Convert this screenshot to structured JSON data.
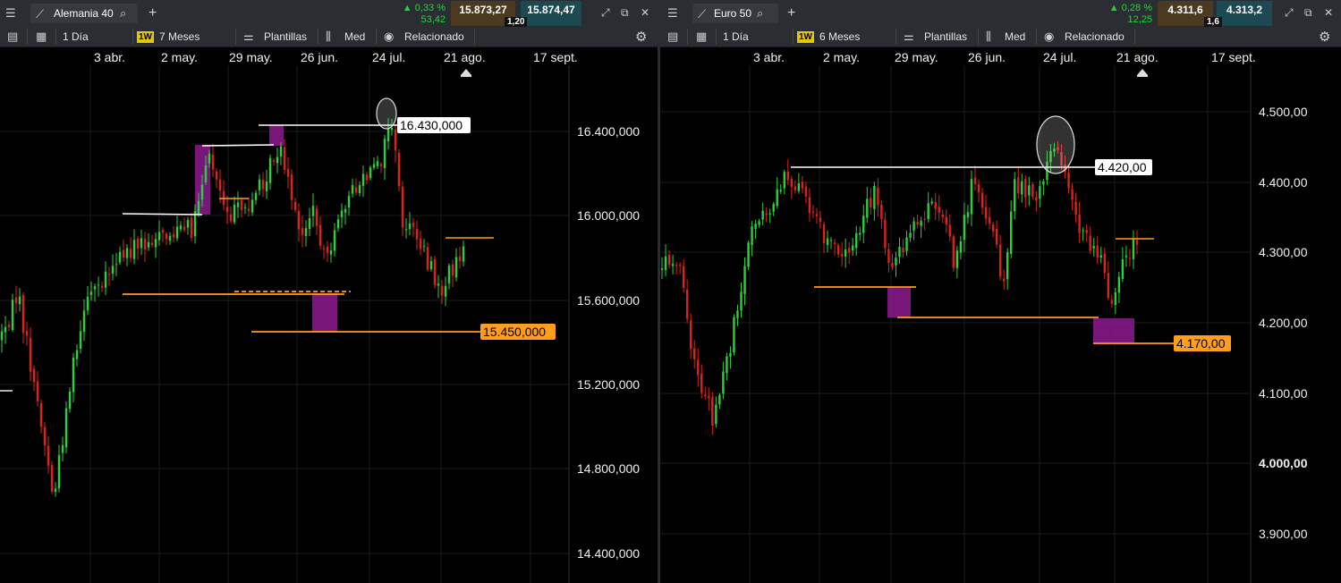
{
  "left": {
    "instrument": "Alemania 40",
    "change_pct": "0,33 %",
    "change_pts": "53,42",
    "sell": "15.873,27",
    "buy": "15.874,47",
    "spread": "1,20",
    "interval": "1 Día",
    "badge": "1W",
    "range": "7 Meses",
    "templates": "Plantillas",
    "indicator": "Med",
    "related": "Relacionado",
    "dates": [
      "3 abr.",
      "2 may.",
      "29 may.",
      "26 jun.",
      "24 jul.",
      "21 ago.",
      "17 sept."
    ],
    "y_labels": [
      "16.400,000",
      "16.000,000",
      "15.600,000",
      "15.200,000",
      "14.800,000",
      "14.400,000"
    ],
    "resistance_label": "16.430,000",
    "support_label": "15.450,000"
  },
  "right": {
    "instrument": "Euro 50",
    "change_pct": "0,28 %",
    "change_pts": "12,25",
    "sell": "4.311,6",
    "buy": "4.313,2",
    "spread": "1,6",
    "interval": "1 Día",
    "badge": "1W",
    "range": "6 Meses",
    "templates": "Plantillas",
    "indicator": "Med",
    "related": "Relacionado",
    "dates": [
      "3 abr.",
      "2 may.",
      "29 may.",
      "26 jun.",
      "24 jul.",
      "21 ago.",
      "17 sept."
    ],
    "y_labels": [
      "4.500,00",
      "4.400,00",
      "4.300,00",
      "4.200,00",
      "4.100,00",
      "4.000,00",
      "3.900,00"
    ],
    "resistance_label": "4.420,00",
    "support_label": "4.170,00"
  },
  "colors": {
    "up": "#27d33b",
    "down": "#e0201e",
    "support": "#ff9e1b",
    "resistance": "#ffffff",
    "zone": "#8e1a8e",
    "bar": "#2a2d31"
  },
  "icons": [
    "menu-icon",
    "chart-icon",
    "search-icon",
    "plus-icon",
    "expand-icon",
    "popout-icon",
    "close-icon",
    "settings-icon"
  ]
}
